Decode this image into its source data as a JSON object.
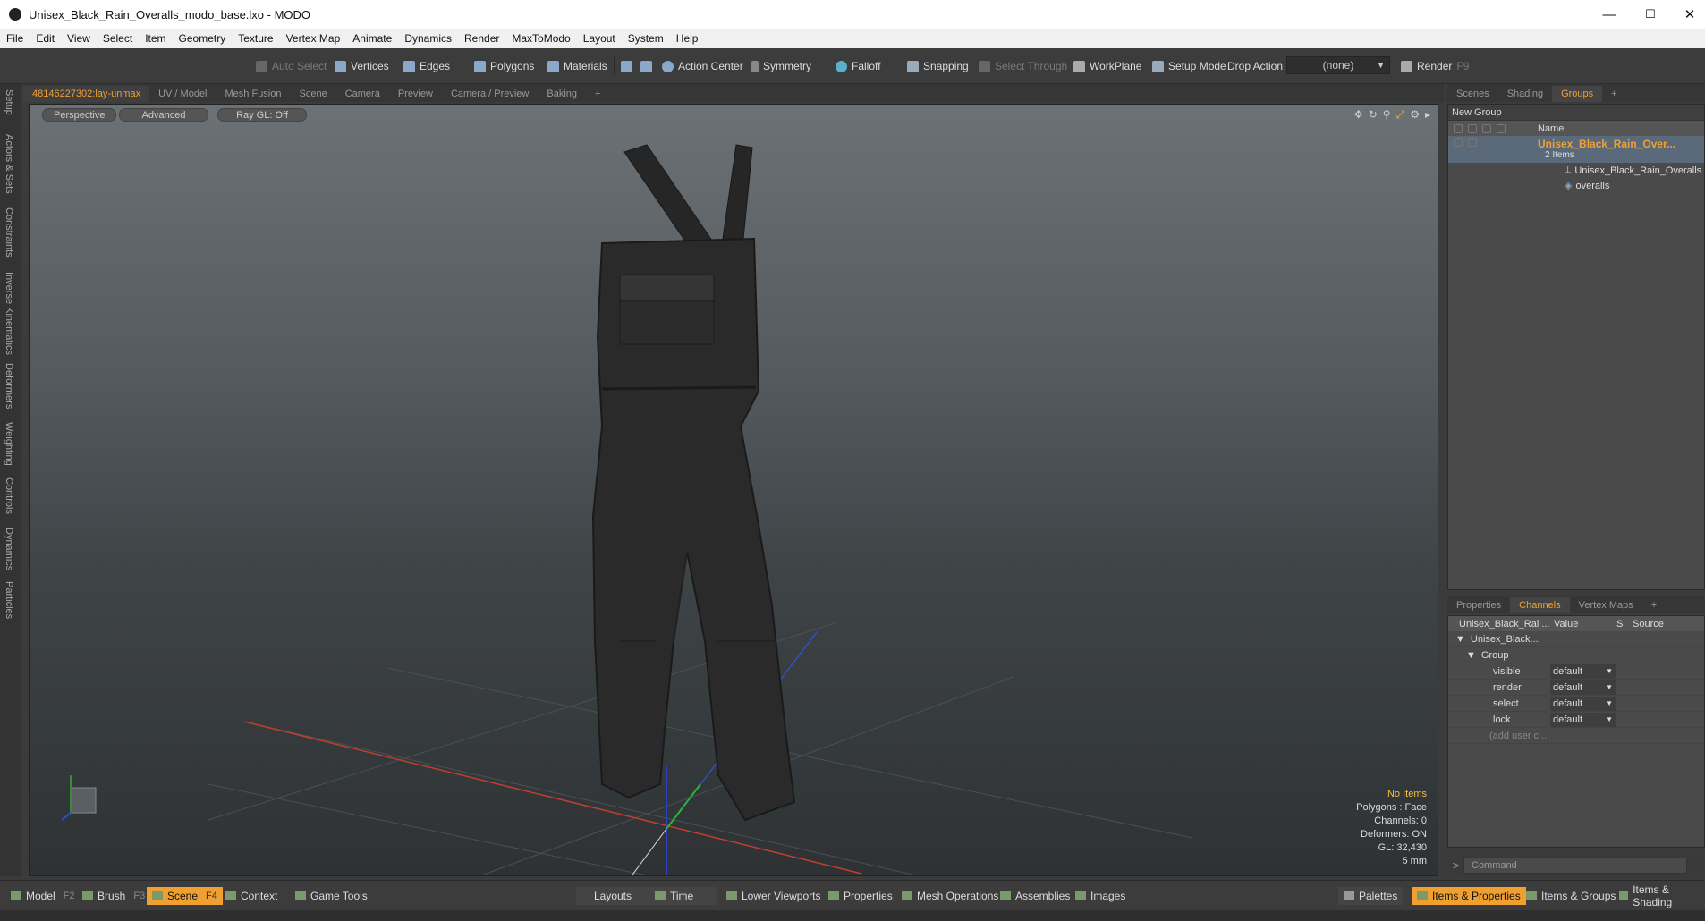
{
  "window": {
    "title": "Unisex_Black_Rain_Overalls_modo_base.lxo - MODO",
    "minimize": "—",
    "maximize": "☐",
    "close": "✕"
  },
  "menu": [
    "File",
    "Edit",
    "View",
    "Select",
    "Item",
    "Geometry",
    "Texture",
    "Vertex Map",
    "Animate",
    "Dynamics",
    "Render",
    "MaxToModo",
    "Layout",
    "System",
    "Help"
  ],
  "toolbar": {
    "auto_select": "Auto Select",
    "vertices": "Vertices",
    "edges": "Edges",
    "polygons": "Polygons",
    "materials": "Materials",
    "action_center": "Action Center",
    "symmetry": "Symmetry",
    "falloff": "Falloff",
    "snapping": "Snapping",
    "select_through": "Select Through",
    "workplane": "WorkPlane",
    "setup_mode": "Setup Mode",
    "drop_action": "Drop Action",
    "drop_value": "(none)",
    "render": "Render",
    "render_key": "F9"
  },
  "left_tabs": [
    "Setup",
    "Actors & Sets",
    "Constraints",
    "Inverse Kinematics",
    "Deformers",
    "Weighting",
    "Controls",
    "Dynamics",
    "Particles"
  ],
  "viewport_tabs": [
    "48146227302:lay-unmax",
    "UV / Model",
    "Mesh Fusion",
    "Scene",
    "Camera",
    "Preview",
    "Camera / Preview",
    "Baking",
    "+"
  ],
  "viewport": {
    "perspective": "Perspective",
    "advanced": "Advanced",
    "raygl": "Ray GL: Off",
    "status": {
      "items": "No Items",
      "polygons": "Polygons : Face",
      "channels": "Channels: 0",
      "deformers": "Deformers: ON",
      "gl": "GL: 32,430",
      "scale": "5 mm"
    }
  },
  "right_tabs": [
    "Scenes",
    "Shading",
    "Groups",
    "+"
  ],
  "groups": {
    "new_group": "New Group",
    "col_name": "Name",
    "root": "Unisex_Black_Rain_Over...",
    "root_count": "2 Items",
    "children": [
      "Unisex_Black_Rain_Overalls",
      "overalls"
    ]
  },
  "props_tabs": [
    "Properties",
    "Channels",
    "Vertex Maps",
    "+"
  ],
  "channels": {
    "col_item": "Unisex_Black_Rai ...",
    "col_value": "Value",
    "col_s": "S",
    "col_source": "Source",
    "item": "Unisex_Black...",
    "group": "Group",
    "rows": [
      {
        "name": "visible",
        "value": "default"
      },
      {
        "name": "render",
        "value": "default"
      },
      {
        "name": "select",
        "value": "default"
      },
      {
        "name": "lock",
        "value": "default"
      }
    ],
    "add_user": "(add user c..."
  },
  "command": {
    "placeholder": "Command",
    "prompt": ">"
  },
  "bottom": {
    "model": "Model",
    "model_key": "F2",
    "brush": "Brush",
    "brush_key": "F3",
    "scene": "Scene",
    "scene_key": "F4",
    "context": "Context",
    "game_tools": "Game Tools",
    "layouts": "Layouts",
    "time": "Time",
    "lower_viewports": "Lower Viewports",
    "properties": "Properties",
    "mesh_operations": "Mesh Operations",
    "assemblies": "Assemblies",
    "images": "Images",
    "palettes": "Palettes",
    "items_properties": "Items & Properties",
    "items_groups": "Items & Groups",
    "items_shading": "Items & Shading"
  }
}
